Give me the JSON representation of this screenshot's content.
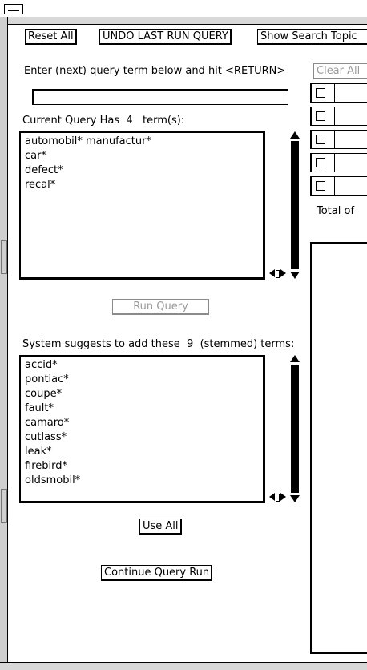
{
  "toolbar": {
    "reset_all": "Reset All",
    "undo_last_run_query": "UNDO LAST RUN QUERY",
    "show_search_topic": "Show Search Topic"
  },
  "query_entry": {
    "instruction": "Enter (next) query term below and hit <RETURN>",
    "value": ""
  },
  "current_query": {
    "label": "Current Query Has  4   term(s):",
    "terms": [
      "automobil* manufactur*",
      "car*",
      "defect*",
      "recal*"
    ]
  },
  "run_query": {
    "label": "Run Query"
  },
  "suggestions": {
    "label": "System suggests to add these  9  (stemmed) terms:",
    "terms": [
      "accid*",
      "pontiac*",
      "coupe*",
      "fault*",
      "camaro*",
      "cutlass*",
      "leak*",
      "firebird*",
      "oldsmobil*"
    ]
  },
  "use_all": {
    "label": "Use All"
  },
  "continue_query_run": {
    "label": "Continue Query Run"
  },
  "right_panel": {
    "clear_all": "Clear All",
    "total_of": "Total of"
  },
  "colors": {
    "disabled_text": "#9a9a9a",
    "frame": "#000000",
    "background": "#ffffff"
  }
}
